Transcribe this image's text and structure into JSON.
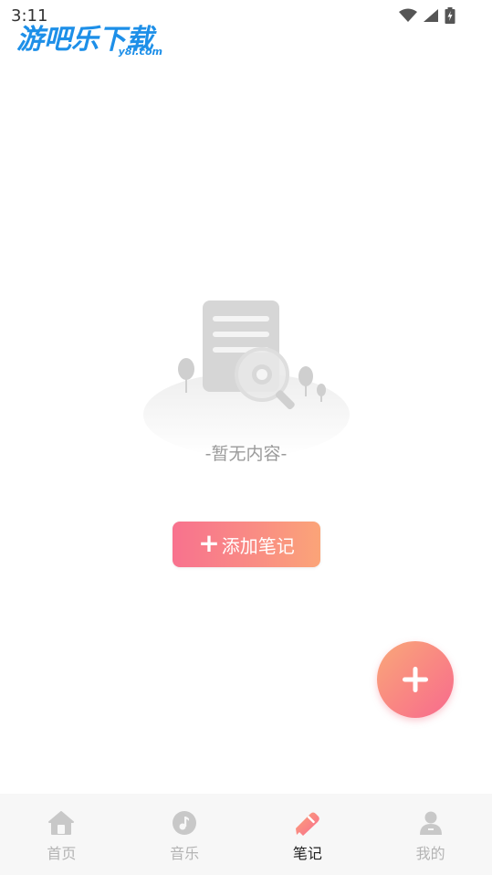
{
  "status_bar": {
    "time": "3:11"
  },
  "watermark": {
    "title": "游吧乐下载",
    "subtitle": "y8l.com"
  },
  "empty_state": {
    "message": "-暂无内容-"
  },
  "add_note_button": {
    "label": "添加笔记"
  },
  "bottom_nav": {
    "items": [
      {
        "label": "首页",
        "icon": "home-icon",
        "active": false
      },
      {
        "label": "音乐",
        "icon": "music-icon",
        "active": false
      },
      {
        "label": "笔记",
        "icon": "note-pencil-icon",
        "active": true
      },
      {
        "label": "我的",
        "icon": "user-icon",
        "active": false
      }
    ]
  },
  "colors": {
    "accent_start": "#f8728e",
    "accent_end": "#fba478",
    "inactive_nav": "#b4b4b4",
    "active_nav": "#222222",
    "watermark": "#1d8fe8"
  }
}
